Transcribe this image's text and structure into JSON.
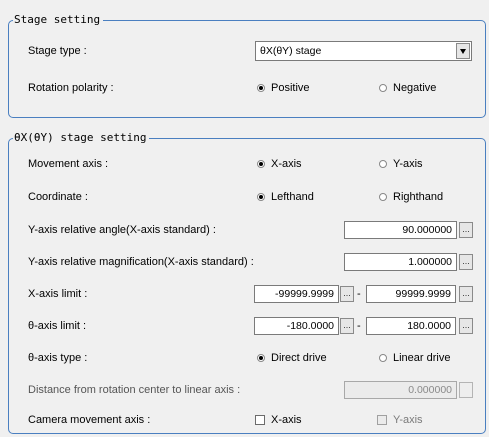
{
  "stage_setting": {
    "title": "Stage setting",
    "stage_type_label": "Stage type :",
    "stage_type_value": "θX(θY) stage",
    "rotation_polarity_label": "Rotation polarity :",
    "polarity_positive": "Positive",
    "polarity_negative": "Negative",
    "polarity_selected": "Positive"
  },
  "theta_stage_setting": {
    "title": "θX(θY) stage setting",
    "movement_axis_label": "Movement axis :",
    "movement_axis_x": "X-axis",
    "movement_axis_y": "Y-axis",
    "coordinate_label": "Coordinate :",
    "coordinate_left": "Lefthand",
    "coordinate_right": "Righthand",
    "y_rel_angle_label": "Y-axis relative angle(X-axis standard) :",
    "y_rel_angle_value": "90.000000",
    "y_rel_mag_label": "Y-axis relative magnification(X-axis standard) :",
    "y_rel_mag_value": "1.000000",
    "x_limit_label": "X-axis limit :",
    "x_limit_min": "-99999.9999",
    "x_limit_max": "99999.9999",
    "theta_limit_label": "θ-axis limit :",
    "theta_limit_min": "-180.0000",
    "theta_limit_max": "180.0000",
    "theta_type_label": "θ-axis type :",
    "theta_type_direct": "Direct drive",
    "theta_type_linear": "Linear drive",
    "distance_label": "Distance from rotation center to linear axis :",
    "distance_value": "0.000000",
    "camera_axis_label": "Camera movement axis :",
    "camera_axis_x": "X-axis",
    "camera_axis_y": "Y-axis",
    "range_separator": "-",
    "browse_label": "..."
  }
}
